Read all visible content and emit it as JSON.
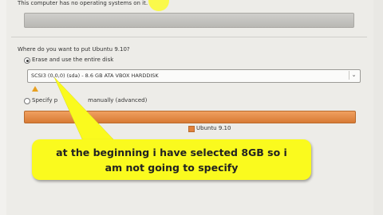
{
  "window": {
    "top_message": "This computer has no operating systems on it."
  },
  "partition": {
    "question": "Where do you want to put Ubuntu 9.10?",
    "option_erase": "Erase and use the entire disk",
    "disk_select": "SCSI3 (0,0,0) (sda) - 8.6 GB ATA VBOX HARDDISK",
    "option_manual_prefix": "Specify p",
    "option_manual_suffix": "manually (advanced)",
    "legend_label": "Ubuntu 9.10"
  },
  "annotation": {
    "line1": "at the beginning i have selected 8GB so i",
    "line2": "am not going to specify"
  },
  "colors": {
    "panel": "#edece8",
    "partition_bar": "#e0823c",
    "callout": "#fafa1e"
  },
  "icons": [
    "warning-icon",
    "chevron-down-icon"
  ]
}
